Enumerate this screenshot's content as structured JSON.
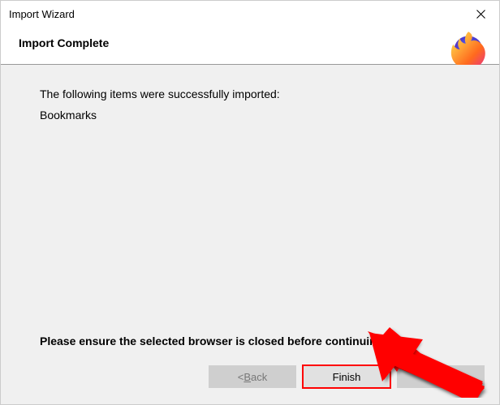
{
  "titlebar": {
    "title": "Import Wizard"
  },
  "header": {
    "title": "Import Complete"
  },
  "content": {
    "message": "The following items were successfully imported:",
    "item": "Bookmarks",
    "warning": "Please ensure the selected browser is closed before continuing."
  },
  "buttons": {
    "back_prefix": "< ",
    "back_letter": "B",
    "back_rest": "ack",
    "finish": "Finish",
    "cancel": "Cancel"
  },
  "icons": {
    "close": "close-icon",
    "logo": "firefox-logo"
  }
}
